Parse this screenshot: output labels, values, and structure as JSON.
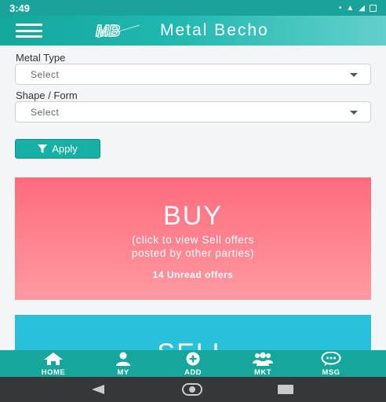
{
  "status_bar": {
    "time": "3:49"
  },
  "app_bar": {
    "title": "Metal Becho"
  },
  "filters": {
    "metal_type_label": "Metal Type",
    "metal_type_value": "Select",
    "shape_label": "Shape / Form",
    "shape_value": "Select",
    "apply_label": "Apply"
  },
  "buy_card": {
    "title": "BUY",
    "line1": "(click to view Sell offers",
    "line2": "posted by other parties)",
    "unread": "14 Unread offers"
  },
  "sell_card": {
    "title": "SELL"
  },
  "bottom_nav": {
    "items": [
      {
        "label": "HOME",
        "icon": "home-icon"
      },
      {
        "label": "MY",
        "icon": "user-icon"
      },
      {
        "label": "ADD",
        "icon": "add-icon"
      },
      {
        "label": "MKT",
        "icon": "users-group-icon"
      },
      {
        "label": "MSG",
        "icon": "chat-icon"
      }
    ]
  },
  "colors": {
    "primary": "#15a69c",
    "buy_card": "#ff7a88",
    "sell_card": "#29c1d9",
    "system_nav": "#353738"
  }
}
